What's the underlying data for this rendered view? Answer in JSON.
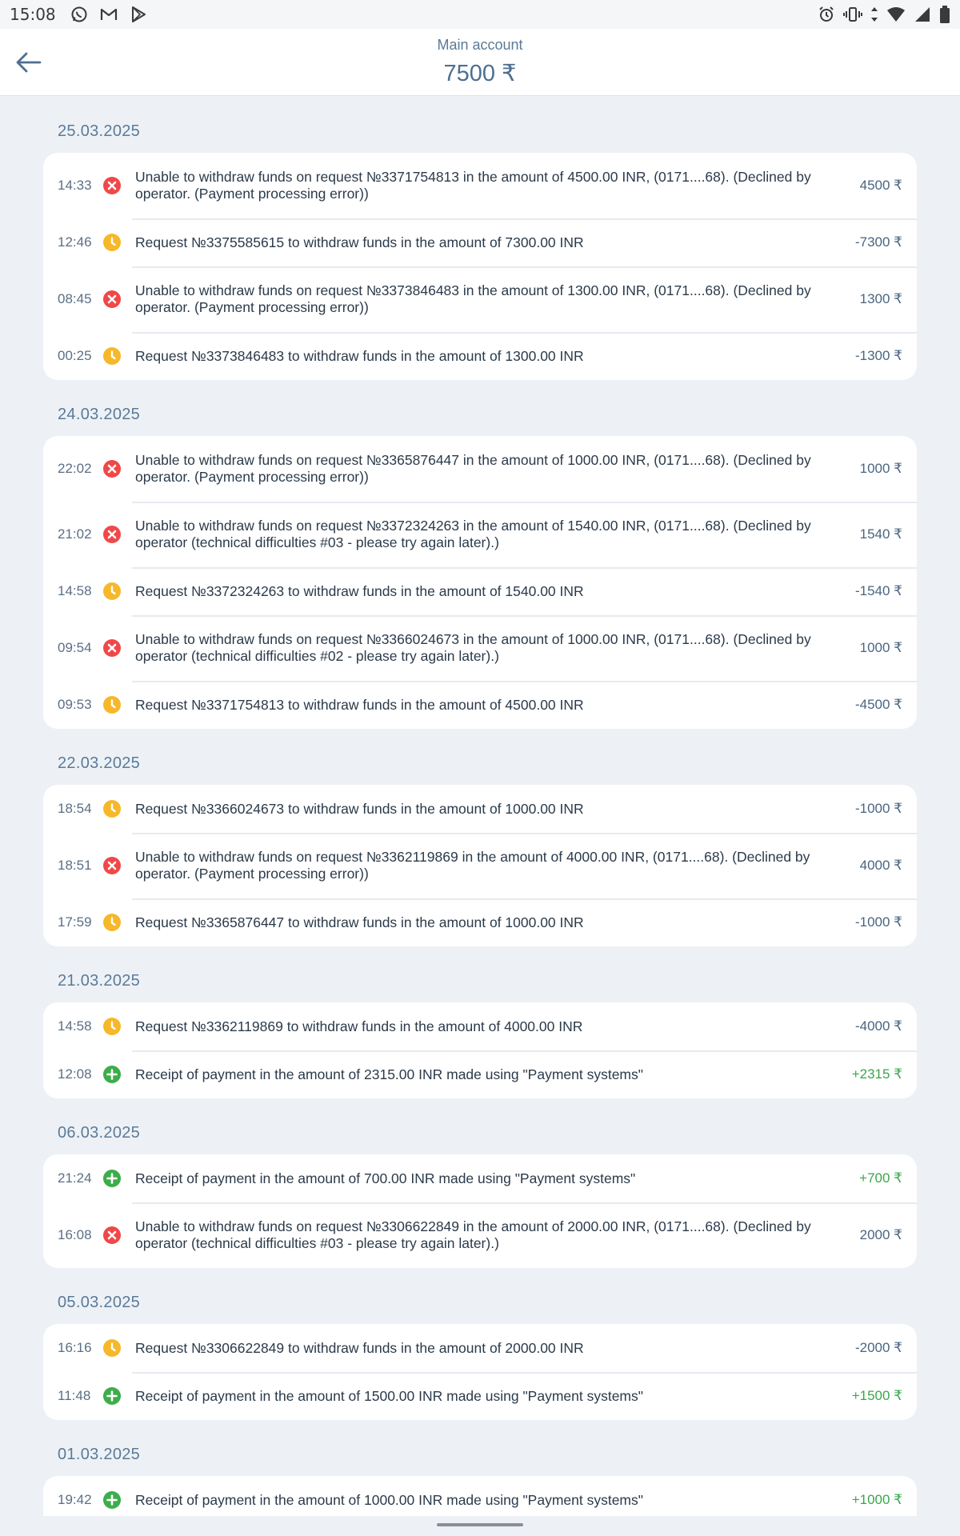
{
  "status_bar": {
    "time": "15:08",
    "left_icons": [
      "whatsapp-icon",
      "gmail-icon",
      "play-store-icon"
    ],
    "right_icons": [
      "alarm-icon",
      "vibrate-icon",
      "data-arrows-icon",
      "wifi-icon",
      "signal-icon",
      "battery-icon"
    ]
  },
  "header": {
    "title": "Main account",
    "balance": "7500 ₹"
  },
  "colors": {
    "declined": "#f04848",
    "pending": "#f6b82a",
    "receipt": "#3dad4a",
    "date": "#5b7a99"
  },
  "days": [
    {
      "date": "25.03.2025",
      "items": [
        {
          "time": "14:33",
          "status": "declined",
          "text": "Unable to withdraw funds on request №3371754813 in the amount of 4500.00 INR,  (0171....68). (Declined by operator. (Payment processing error))",
          "amount": "4500 ₹"
        },
        {
          "time": "12:46",
          "status": "pending",
          "text": "Request №3375585615 to withdraw funds in the amount of 7300.00 INR",
          "amount": "-7300 ₹"
        },
        {
          "time": "08:45",
          "status": "declined",
          "text": "Unable to withdraw funds on request №3373846483 in the amount of 1300.00 INR,  (0171....68). (Declined by operator. (Payment processing error))",
          "amount": "1300 ₹"
        },
        {
          "time": "00:25",
          "status": "pending",
          "text": "Request №3373846483 to withdraw funds in the amount of 1300.00 INR",
          "amount": "-1300 ₹"
        }
      ]
    },
    {
      "date": "24.03.2025",
      "items": [
        {
          "time": "22:02",
          "status": "declined",
          "text": "Unable to withdraw funds on request №3365876447 in the amount of 1000.00 INR,  (0171....68). (Declined by operator. (Payment processing error))",
          "amount": "1000 ₹"
        },
        {
          "time": "21:02",
          "status": "declined",
          "text": "Unable to withdraw funds on request №3372324263 in the amount of 1540.00 INR,  (0171....68). (Declined by operator (technical difficulties #03 - please try again later).)",
          "amount": "1540 ₹"
        },
        {
          "time": "14:58",
          "status": "pending",
          "text": "Request №3372324263 to withdraw funds in the amount of 1540.00 INR",
          "amount": "-1540 ₹"
        },
        {
          "time": "09:54",
          "status": "declined",
          "text": "Unable to withdraw funds on request №3366024673 in the amount of 1000.00 INR,  (0171....68). (Declined by operator (technical difficulties #02 - please try again later).)",
          "amount": "1000 ₹"
        },
        {
          "time": "09:53",
          "status": "pending",
          "text": "Request №3371754813 to withdraw funds in the amount of 4500.00 INR",
          "amount": "-4500 ₹"
        }
      ]
    },
    {
      "date": "22.03.2025",
      "items": [
        {
          "time": "18:54",
          "status": "pending",
          "text": "Request №3366024673 to withdraw funds in the amount of 1000.00 INR",
          "amount": "-1000 ₹"
        },
        {
          "time": "18:51",
          "status": "declined",
          "text": "Unable to withdraw funds on request №3362119869 in the amount of 4000.00 INR,  (0171....68). (Declined by operator. (Payment processing error))",
          "amount": "4000 ₹"
        },
        {
          "time": "17:59",
          "status": "pending",
          "text": "Request №3365876447 to withdraw funds in the amount of 1000.00 INR",
          "amount": "-1000 ₹"
        }
      ]
    },
    {
      "date": "21.03.2025",
      "items": [
        {
          "time": "14:58",
          "status": "pending",
          "text": "Request №3362119869 to withdraw funds in the amount of 4000.00 INR",
          "amount": "-4000 ₹"
        },
        {
          "time": "12:08",
          "status": "receipt",
          "text": "Receipt of payment in the amount of 2315.00 INR made using \"Payment systems\"",
          "amount": "+2315 ₹"
        }
      ]
    },
    {
      "date": "06.03.2025",
      "items": [
        {
          "time": "21:24",
          "status": "receipt",
          "text": "Receipt of payment in the amount of 700.00 INR made using \"Payment systems\"",
          "amount": "+700 ₹"
        },
        {
          "time": "16:08",
          "status": "declined",
          "text": "Unable to withdraw funds on request №3306622849 in the amount of 2000.00 INR,  (0171....68). (Declined by operator (technical difficulties #03 - please try again later).)",
          "amount": "2000 ₹"
        }
      ]
    },
    {
      "date": "05.03.2025",
      "items": [
        {
          "time": "16:16",
          "status": "pending",
          "text": "Request №3306622849 to withdraw funds in the amount of 2000.00 INR",
          "amount": "-2000 ₹"
        },
        {
          "time": "11:48",
          "status": "receipt",
          "text": "Receipt of payment in the amount of 1500.00 INR made using \"Payment systems\"",
          "amount": "+1500 ₹"
        }
      ]
    },
    {
      "date": "01.03.2025",
      "items": [
        {
          "time": "19:42",
          "status": "receipt",
          "text": "Receipt of payment in the amount of 1000.00 INR made using \"Payment systems\"",
          "amount": "+1000 ₹"
        },
        {
          "time": "",
          "status": "",
          "text": "",
          "amount": ""
        }
      ]
    }
  ]
}
